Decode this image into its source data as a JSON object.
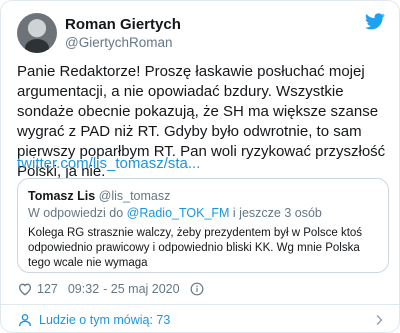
{
  "colors": {
    "link": "#1b95e0",
    "secondary": "#657786",
    "text": "#14171a",
    "border": "#e1e8ed"
  },
  "author": {
    "name": "Roman Giertych",
    "handle": "@GiertychRoman"
  },
  "icons": {
    "brand": "twitter-bird-icon",
    "like": "heart-icon",
    "info": "info-icon",
    "people": "person-icon",
    "expand": "chevron-right-icon"
  },
  "tweet": {
    "text": "Panie Redaktorze! Proszę łaskawie posłuchać mojej argumentacji, a nie opowiadać bzdury. Wszystkie sondaże obecnie pokazują, że SH ma większe szanse wygrać z PAD niż RT. Gdyby było odwrotnie, to sam pierwszy poparłbym RT. Pan woli ryzykować przyszłość Polski, ja nie.",
    "link": "twitter.com/lis_tomasz/sta..."
  },
  "quote": {
    "name": "Tomasz Lis",
    "handle": "@lis_tomasz",
    "reply_prefix": "W odpowiedzi do ",
    "reply_to": "@Radio_TOK_FM",
    "reply_suffix": " i jeszcze 3 osób",
    "text": "Kolega RG strasznie walczy, żeby prezydentem był w Polsce  ktoś odpowiednio prawicowy i odpowiednio bliski KK. Wg mnie Polska tego wcale nie wymaga"
  },
  "meta": {
    "likes": "127",
    "time": "09:32",
    "date": "- 25 maj 2020"
  },
  "footer": {
    "label": "Ludzie o tym mówią: 73"
  }
}
